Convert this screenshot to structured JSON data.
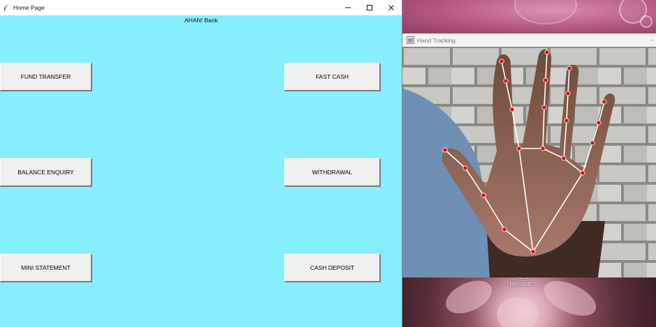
{
  "home_window": {
    "title": "Home Page",
    "bank_name": "AHAN! Bank",
    "background_color": "#86eefc",
    "buttons": {
      "fund_transfer": "FUND TRANSFER",
      "fast_cash": "FAST CASH",
      "balance_enquiry": "BALANCE ENQUIRY",
      "withdrawal": "WITHDRAWAL",
      "mini_statement": "MINI STATEMENT",
      "cash_deposit": "CASH DEPOSIT"
    },
    "controls": {
      "minimize": "minimize-icon",
      "maximize": "maximize-icon",
      "close": "close-icon"
    }
  },
  "hand_window": {
    "title": "Hand Tracking",
    "landmark_color": "#e01010",
    "connection_color": "#ffffff"
  },
  "desktop": {
    "tooltip_line1": "New",
    "tooltip_line2": "Microsof..."
  }
}
